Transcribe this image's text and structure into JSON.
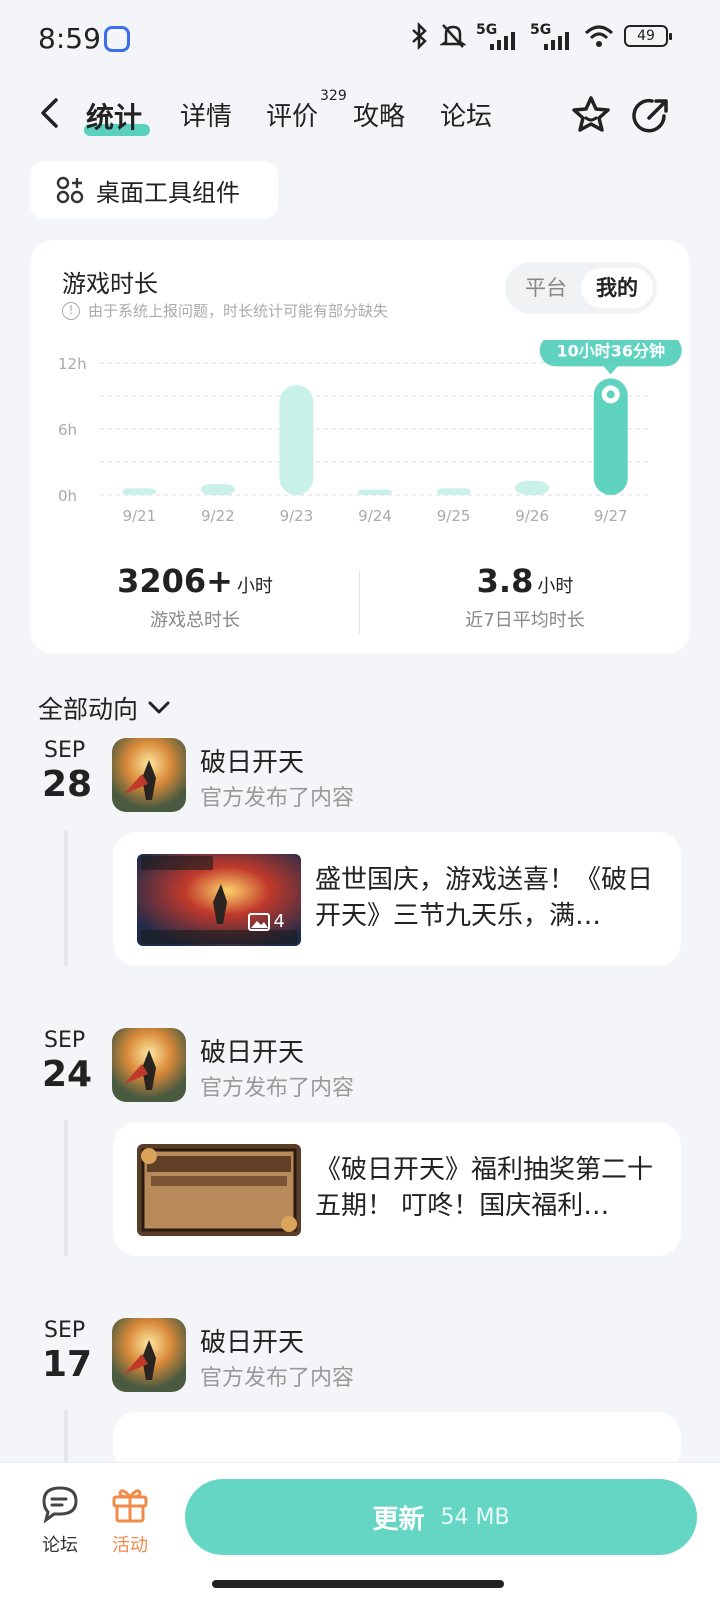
{
  "status_bar": {
    "time": "8:59",
    "network_1": "5G",
    "network_2": "5G",
    "battery": "49"
  },
  "nav": {
    "tabs": [
      {
        "label": "统计",
        "active": true
      },
      {
        "label": "详情"
      },
      {
        "label": "评价"
      },
      {
        "label": "攻略"
      },
      {
        "label": "论坛"
      }
    ],
    "review_badge": "329"
  },
  "widget_chip": {
    "label": "桌面工具组件",
    "icon": "widgets-icon"
  },
  "playtime_card": {
    "title": "游戏时长",
    "note": "由于系统上报问题，时长统计可能有部分缺失",
    "toggle": {
      "options": [
        "平台",
        "我的"
      ],
      "selected": "我的"
    },
    "summary": [
      {
        "value": "3206",
        "suffix": "+",
        "unit": "小时",
        "label": "游戏总时长"
      },
      {
        "value": "3.8",
        "suffix": "",
        "unit": "小时",
        "label": "近7日平均时长"
      }
    ]
  },
  "chart_data": {
    "type": "bar",
    "categories": [
      "9/21",
      "9/22",
      "9/23",
      "9/24",
      "9/25",
      "9/26",
      "9/27"
    ],
    "values": [
      0.6,
      1.0,
      10.0,
      0.5,
      0.6,
      1.3,
      10.6
    ],
    "yticks": [
      "12h",
      "6h",
      "0h"
    ],
    "ylim": [
      0,
      12
    ],
    "highlight_index": 6,
    "highlight_label": "10小时36分钟",
    "colors": {
      "bar": "#c9f1ea",
      "highlight": "#5fd3bf"
    },
    "grid": true
  },
  "feed": {
    "filter_label": "全部动向",
    "posts": [
      {
        "month": "SEP",
        "day": "28",
        "name": "破日开天",
        "action": "官方发布了内容",
        "text": "盛世国庆，游戏送喜！《破日开天》三节九天乐，满…",
        "image_count": "4"
      },
      {
        "month": "SEP",
        "day": "24",
        "name": "破日开天",
        "action": "官方发布了内容",
        "text": "《破日开天》福利抽奖第二十五期！ 叮咚！国庆福利…"
      },
      {
        "month": "SEP",
        "day": "17",
        "name": "破日开天",
        "action": "官方发布了内容"
      }
    ]
  },
  "bottom_bar": {
    "forum_label": "论坛",
    "activity_label": "活动",
    "update_label": "更新",
    "update_size": "54 MB",
    "colors": {
      "accent": "#65d6c3",
      "activity": "#f08b4a"
    }
  }
}
